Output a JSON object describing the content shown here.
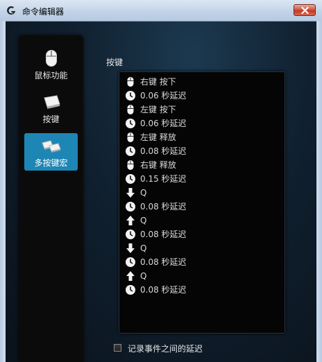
{
  "window": {
    "title": "命令编辑器"
  },
  "sidebar": {
    "items": [
      {
        "label": "鼠标功能",
        "icon": "mouse-icon",
        "active": false
      },
      {
        "label": "按键",
        "icon": "key-icon",
        "active": false
      },
      {
        "label": "多按键宏",
        "icon": "multi-key-icon",
        "active": true
      }
    ]
  },
  "main": {
    "section_label": "按键",
    "events": [
      {
        "icon": "mouse-icon",
        "text": "右键 按下"
      },
      {
        "icon": "clock-icon",
        "text": "0.06 秒延迟"
      },
      {
        "icon": "mouse-icon",
        "text": "左键 按下"
      },
      {
        "icon": "clock-icon",
        "text": "0.06 秒延迟"
      },
      {
        "icon": "mouse-icon",
        "text": "左键 释放"
      },
      {
        "icon": "clock-icon",
        "text": "0.08 秒延迟"
      },
      {
        "icon": "mouse-icon",
        "text": "右键 释放"
      },
      {
        "icon": "clock-icon",
        "text": "0.15 秒延迟"
      },
      {
        "icon": "arrow-down-icon",
        "text": "Q"
      },
      {
        "icon": "clock-icon",
        "text": "0.08 秒延迟"
      },
      {
        "icon": "arrow-up-icon",
        "text": "Q"
      },
      {
        "icon": "clock-icon",
        "text": "0.08 秒延迟"
      },
      {
        "icon": "arrow-down-icon",
        "text": "Q"
      },
      {
        "icon": "clock-icon",
        "text": "0.08 秒延迟"
      },
      {
        "icon": "arrow-up-icon",
        "text": "Q"
      },
      {
        "icon": "clock-icon",
        "text": "0.08 秒延迟"
      }
    ],
    "record_delay_label": "记录事件之间的延迟",
    "record_delay_checked": false
  },
  "colors": {
    "active_tab": "#1e86b5",
    "background": "#10202f",
    "list_background": "#050505"
  }
}
